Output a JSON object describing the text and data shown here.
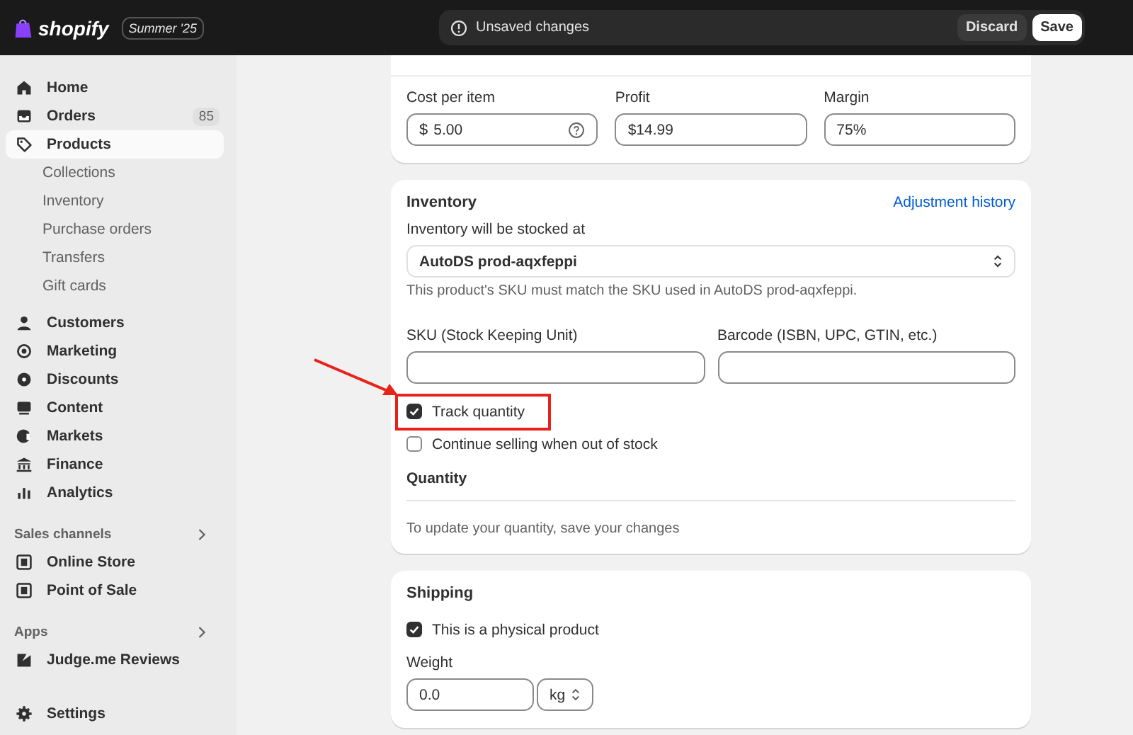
{
  "topbar": {
    "logo": "shopify",
    "badge": "Summer '25",
    "notice": "Unsaved changes",
    "buttons": [
      "Discard",
      "Save"
    ]
  },
  "sidebar": {
    "items": [
      {
        "label": "Home",
        "selected": false
      },
      {
        "label": "Orders",
        "count": "85",
        "selected": false
      },
      {
        "label": "Products",
        "selected": true,
        "children": [
          {
            "label": "Collections"
          },
          {
            "label": "Inventory"
          },
          {
            "label": "Purchase orders"
          },
          {
            "label": "Transfers"
          },
          {
            "label": "Gift cards"
          }
        ]
      },
      {
        "label": "Customers",
        "selected": false
      },
      {
        "label": "Marketing",
        "selected": false
      },
      {
        "label": "Discounts",
        "selected": false
      },
      {
        "label": "Content",
        "selected": false
      },
      {
        "label": "Markets",
        "selected": false
      },
      {
        "label": "Finance",
        "selected": false
      },
      {
        "label": "Analytics",
        "selected": false
      }
    ],
    "sections": [
      {
        "title": "Sales channels",
        "items": [
          {
            "label": "Online Store"
          },
          {
            "label": "Point of Sale"
          }
        ]
      },
      {
        "title": "Apps",
        "items": [
          {
            "label": "Judge.me Reviews"
          }
        ]
      }
    ],
    "settings": "Settings"
  },
  "pricing": {
    "fields": [
      {
        "label": "Cost per item",
        "prefix": "$",
        "value": "5.00",
        "help": true
      },
      {
        "label": "Profit",
        "value": "$14.99",
        "help": false
      },
      {
        "label": "Margin",
        "value": "75%",
        "help": false
      }
    ]
  },
  "inventory": {
    "title": "Inventory",
    "link": "Adjustment history",
    "location_label": "Inventory will be stocked at",
    "location": "AutoDS prod-aqxfeppi",
    "location_help": "This product's SKU must match the SKU used in AutoDS prod-aqxfeppi.",
    "fields": [
      {
        "label": "SKU (Stock Keeping Unit)"
      },
      {
        "label": "Barcode (ISBN, UPC, GTIN, etc.)"
      }
    ],
    "checkboxes": [
      {
        "label": "Track quantity",
        "checked": true,
        "highlighted": true
      },
      {
        "label": "Continue selling when out of stock",
        "checked": false,
        "highlighted": false
      }
    ],
    "quantity_title": "Quantity",
    "quantity_note": "To update your quantity, save your changes"
  },
  "shipping": {
    "title": "Shipping",
    "checkbox": {
      "label": "This is a physical product",
      "checked": true
    },
    "weight_label": "Weight",
    "weight": "0.0",
    "unit": "kg"
  }
}
